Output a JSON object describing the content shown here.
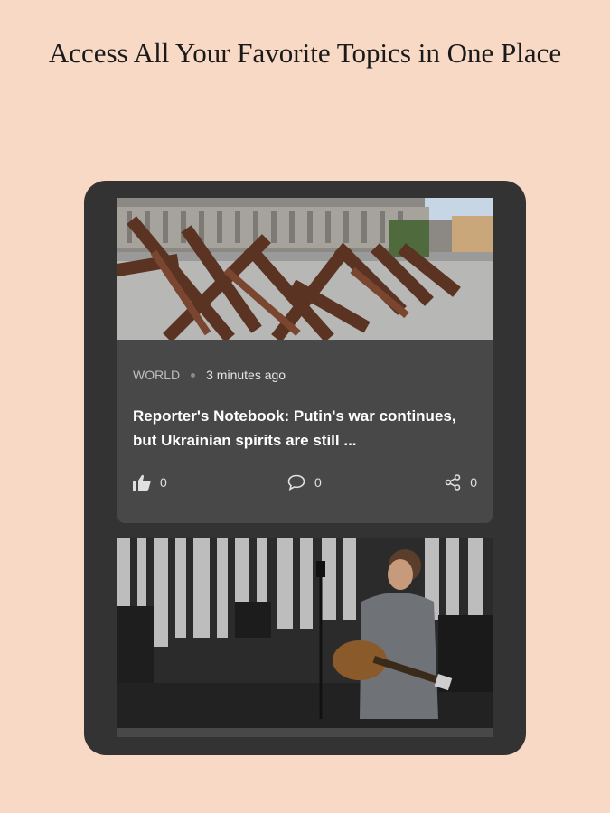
{
  "headline": "Access All Your Favorite Topics in One Place",
  "articles": [
    {
      "category": "WORLD",
      "time": "3 minutes ago",
      "title": "Reporter's Notebook: Putin's war continues, but Ukrainian spirits are still ...",
      "likes": "0",
      "comments": "0",
      "shares": "0",
      "image": "anti-tank-hedgehogs-photo"
    },
    {
      "image": "guitarist-singing-photo"
    }
  ],
  "icons": {
    "like": "thumbs-up-icon",
    "comment": "comment-bubble-icon",
    "share": "share-icon"
  },
  "colors": {
    "background": "#f8d9c5",
    "tablet": "#333333",
    "card": "#484848"
  }
}
